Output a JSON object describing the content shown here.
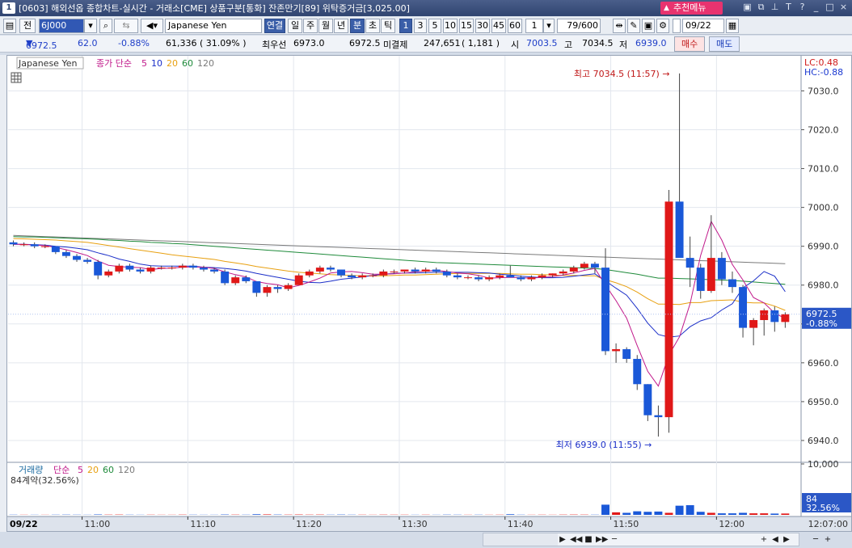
{
  "window": {
    "number": "1",
    "title": "[0603] 해외선옵 종합차트-실시간 - 거래소[CME] 상품구분[통화] 잔존만기[89] 위탁증거금[3,025.00]",
    "recommend_menu": "추천메뉴",
    "icons": [
      "restore-icon",
      "window-icon",
      "pin-icon",
      "text-icon",
      "help-icon",
      "minimize-icon",
      "maximize-icon",
      "close-icon"
    ],
    "icon_glyphs": [
      "▣",
      "⧉",
      "⊥",
      "T",
      "?",
      "_",
      "□",
      "×"
    ]
  },
  "toolbar": {
    "jeon": "전",
    "code": "6J000",
    "name": "Japanese Yen",
    "connect": "연결",
    "periods": [
      "일",
      "주",
      "월",
      "년"
    ],
    "units": [
      "분",
      "초",
      "틱"
    ],
    "intervals": [
      "1",
      "3",
      "5",
      "10",
      "15",
      "30",
      "45",
      "60"
    ],
    "interval_value": "1",
    "count": "79",
    "count_total": "/600",
    "date": "09/22"
  },
  "quote": {
    "price": "6972.5",
    "change": "62.0",
    "change_pct": "-0.88%",
    "volume": "61,336 ( 31.09% )",
    "best_bid_label": "최우선",
    "best_bid": "6973.0",
    "last": "6972.5",
    "open_interest_label": "미결제",
    "open_interest": "247,651",
    "oi_change": "( 1,181 )",
    "open_label": "시",
    "open": "7003.5",
    "high_label": "고",
    "high": "7034.5",
    "low_label": "저",
    "low": "6939.0",
    "buy_label": "매수",
    "sell_label": "매도"
  },
  "price_panel": {
    "legend_name": "Japanese Yen",
    "legend_ma": "종가 단순",
    "ma_periods": [
      "5",
      "10",
      "20",
      "60",
      "120"
    ],
    "ma_colors": [
      "#c0188a",
      "#1a2ec8",
      "#e8a010",
      "#1e8a3a",
      "#7a7a7a"
    ],
    "lc": "LC:0.48",
    "hc": "HC:-0.88",
    "high_annot": "최고 7034.5 (11:57)",
    "low_annot": "최저 6939.0 (11:55)",
    "last_price_label": "6972.5",
    "last_pct_label": "-0.88%"
  },
  "volume_panel": {
    "legend_name": "거래량",
    "legend_ma": "단순",
    "ma_periods": [
      "5",
      "20",
      "60",
      "120"
    ],
    "contracts": "84계약(32.56%)",
    "last_label": "84",
    "last_pct": "32.56%"
  },
  "time_axis": {
    "date": "09/22",
    "ticks": [
      "11:00",
      "11:10",
      "11:20",
      "11:30",
      "11:40",
      "11:50",
      "12:00"
    ],
    "current": "12:07:00"
  },
  "scroll_controls": [
    "▶",
    "◀◀",
    "■",
    "▶▶",
    "─",
    "+",
    "◀",
    "▶",
    "─",
    "+"
  ],
  "chart_data": {
    "type": "candlestick",
    "x_unit": "minute",
    "x_start": "10:53",
    "x_end": "12:07",
    "ylim": [
      6935,
      7038
    ],
    "yticks": [
      "7030.0",
      "7020.0",
      "7010.0",
      "7000.0",
      "6990.0",
      "6980.0",
      "6970.0",
      "6960.0",
      "6950.0",
      "6940.0"
    ],
    "ytick_values": [
      7030,
      7020,
      7010,
      7000,
      6990,
      6980,
      6970,
      6960,
      6950,
      6940
    ],
    "volume_yticks": [
      "10,000"
    ],
    "volume_ylim": [
      0,
      10000
    ],
    "candles": [
      [
        6991,
        6991.5,
        6990,
        6990.5
      ],
      [
        6990.5,
        6991,
        6990,
        6990.5
      ],
      [
        6990.5,
        6991,
        6989.5,
        6990
      ],
      [
        6990,
        6990.5,
        6989.5,
        6990
      ],
      [
        6990,
        6990,
        6988,
        6988.5
      ],
      [
        6988.5,
        6989,
        6987,
        6987.5
      ],
      [
        6987.5,
        6988,
        6986,
        6986.5
      ],
      [
        6986.5,
        6987,
        6985.5,
        6986
      ],
      [
        6986,
        6986.5,
        6981.5,
        6982.5
      ],
      [
        6982.5,
        6984,
        6982,
        6983.5
      ],
      [
        6983.5,
        6985.5,
        6983,
        6985
      ],
      [
        6985,
        6985.5,
        6983.5,
        6984
      ],
      [
        6984,
        6984.5,
        6983,
        6983.5
      ],
      [
        6983.5,
        6985,
        6983,
        6984.5
      ],
      [
        6984.5,
        6985,
        6984,
        6984.5
      ],
      [
        6984.5,
        6985,
        6984,
        6984.5
      ],
      [
        6984.5,
        6985.5,
        6984,
        6985
      ],
      [
        6985,
        6985.5,
        6984,
        6984.5
      ],
      [
        6984.5,
        6985,
        6983.5,
        6984
      ],
      [
        6984,
        6984.5,
        6983,
        6983.5
      ],
      [
        6983.5,
        6984,
        6980,
        6980.5
      ],
      [
        6980.5,
        6982.5,
        6980,
        6982
      ],
      [
        6982,
        6982.5,
        6980.5,
        6981
      ],
      [
        6981,
        6981,
        6977,
        6978
      ],
      [
        6978,
        6980,
        6977,
        6979.5
      ],
      [
        6979.5,
        6980,
        6978,
        6979
      ],
      [
        6979,
        6980.5,
        6978.5,
        6980
      ],
      [
        6980,
        6983,
        6980,
        6982.5
      ],
      [
        6982.5,
        6984,
        6982,
        6983.5
      ],
      [
        6983.5,
        6985,
        6983,
        6984.5
      ],
      [
        6984.5,
        6985,
        6983.5,
        6984
      ],
      [
        6984,
        6984,
        6982,
        6982.5
      ],
      [
        6982.5,
        6983,
        6981.5,
        6982
      ],
      [
        6982,
        6983,
        6981.5,
        6982.5
      ],
      [
        6982.5,
        6983,
        6982,
        6982.5
      ],
      [
        6982.5,
        6984,
        6982,
        6983.5
      ],
      [
        6983.5,
        6984,
        6983,
        6983.5
      ],
      [
        6983.5,
        6984,
        6983,
        6984
      ],
      [
        6984,
        6984.5,
        6983,
        6983.5
      ],
      [
        6983.5,
        6984.5,
        6983,
        6984
      ],
      [
        6984,
        6984.5,
        6983,
        6983.5
      ],
      [
        6983.5,
        6984,
        6982,
        6982.5
      ],
      [
        6982.5,
        6983,
        6981.5,
        6982
      ],
      [
        6982,
        6982.5,
        6981.5,
        6982
      ],
      [
        6982,
        6982.5,
        6981,
        6981.5
      ],
      [
        6981.5,
        6982.5,
        6981,
        6982
      ],
      [
        6982,
        6983,
        6981.5,
        6982.5
      ],
      [
        6982.5,
        6985,
        6982,
        6982
      ],
      [
        6982,
        6982.5,
        6981,
        6981.5
      ],
      [
        6981.5,
        6982.5,
        6981,
        6982
      ],
      [
        6982,
        6983,
        6981.5,
        6982.5
      ],
      [
        6982.5,
        6983,
        6982,
        6983
      ],
      [
        6983,
        6984,
        6982.5,
        6983.5
      ],
      [
        6983.5,
        6985,
        6983,
        6984.5
      ],
      [
        6984.5,
        6986,
        6984,
        6985.5
      ],
      [
        6985.5,
        6986,
        6983,
        6984.5
      ],
      [
        6984.5,
        6989.5,
        6962,
        6963
      ],
      [
        6963,
        6965,
        6960,
        6963.5
      ],
      [
        6963.5,
        6964,
        6960,
        6961
      ],
      [
        6961,
        6962,
        6953,
        6954.5
      ],
      [
        6954.5,
        6954.5,
        6945,
        6946.5
      ],
      [
        6946.5,
        6949,
        6941,
        6946
      ],
      [
        6946,
        7004.5,
        6942,
        7001.5
      ],
      [
        7001.5,
        7034.5,
        6990,
        6987
      ],
      [
        6987,
        6992.5,
        6979.5,
        6984.5
      ],
      [
        6984.5,
        6985.5,
        6976.5,
        6978.5
      ],
      [
        6978.5,
        6998,
        6978,
        6987
      ],
      [
        6987,
        6988.5,
        6980,
        6981.5
      ],
      [
        6981.5,
        6983.5,
        6978,
        6979.5
      ],
      [
        6979.5,
        6980,
        6966.5,
        6969
      ],
      [
        6969,
        6971.5,
        6964.5,
        6971
      ],
      [
        6971,
        6974,
        6967,
        6973.5
      ],
      [
        6973.5,
        6974.5,
        6968,
        6970.5
      ],
      [
        6970.5,
        6973,
        6969,
        6972.5
      ]
    ],
    "ma5": [
      6990.5,
      6990.5,
      6990.3,
      6990.2,
      6989.7,
      6989.1,
      6988.4,
      6987.6,
      6986.2,
      6985.1,
      6984.8,
      6984.6,
      6984.5,
      6984,
      6984.3,
      6984.4,
      6984.6,
      6984.7,
      6984.6,
      6984.3,
      6983.4,
      6982.7,
      6982.1,
      6980.9,
      6980.4,
      6980.1,
      6979.3,
      6979.9,
      6980.8,
      6981.8,
      6983.1,
      6983.4,
      6983.5,
      6983.2,
      6982.8,
      6982.8,
      6982.9,
      6983.1,
      6983.4,
      6983.6,
      6983.8,
      6983.5,
      6983.1,
      6982.9,
      6982.5,
      6981.8,
      6981.9,
      6982,
      6981.9,
      6981.8,
      6982,
      6982.2,
      6982.6,
      6983.1,
      6983.8,
      6984.3,
      6980,
      6976,
      6971.5,
      6964.4,
      6957.8,
      6954,
      6962,
      6966.7,
      6975.2,
      6987.6,
      6996.4,
      6991.6,
      6985.3,
      6981.3,
      6976.8,
      6975.4,
      6972.8,
      6971.4
    ],
    "ma10": [
      6990.5,
      6990.5,
      6990.4,
      6990.3,
      6990,
      6989.8,
      6989.5,
      6989.1,
      6988.3,
      6987.6,
      6986.7,
      6986.1,
      6985.4,
      6985,
      6984.9,
      6984.9,
      6984.9,
      6984.9,
      6984.6,
      6984.5,
      6984.3,
      6984,
      6983.6,
      6983,
      6982.5,
      6982,
      6981.5,
      6981,
      6980.7,
      6980.6,
      6981,
      6981.5,
      6981.8,
      6982.1,
      6982.5,
      6982.8,
      6983,
      6983.1,
      6983.1,
      6983.2,
      6983.3,
      6983.3,
      6983.3,
      6983.3,
      6983.2,
      6983.1,
      6982.8,
      6982.6,
      6982.3,
      6982.1,
      6981.9,
      6981.9,
      6982,
      6982.3,
      6982.6,
      6982.9,
      6981.1,
      6979.2,
      6977.4,
      6974,
      6970.2,
      6967.3,
      6966.6,
      6966.9,
      6969.3,
      6970.8,
      6971.6,
      6973.6,
      6975.2,
      6979.3,
      6981.1,
      6983.5,
      6982.3,
      6978.3
    ],
    "ma20": [
      6992,
      6991.9,
      6991.8,
      6991.7,
      6991.6,
      6991.4,
      6991.2,
      6991,
      6990.6,
      6990.2,
      6989.8,
      6989.4,
      6989,
      6988.6,
      6988.2,
      6987.8,
      6987.5,
      6987.2,
      6986.9,
      6986.6,
      6986.1,
      6985.7,
      6985.3,
      6984.8,
      6984.4,
      6984,
      6983.6,
      6983.3,
      6983.1,
      6982.9,
      6982.7,
      6982.6,
      6982.5,
      6982.4,
      6982.4,
      6982.4,
      6982.5,
      6982.6,
      6982.6,
      6982.7,
      6982.8,
      6982.9,
      6983,
      6983,
      6983,
      6983,
      6983,
      6982.9,
      6982.8,
      6982.8,
      6982.7,
      6982.6,
      6982.5,
      6982.5,
      6982.4,
      6982.4,
      6981.4,
      6980.6,
      6979.6,
      6978.2,
      6976.5,
      6975.1,
      6975.1,
      6975,
      6975.5,
      6975.5,
      6976,
      6976.1,
      6976.2,
      6975.6,
      6975.4,
      6975.4,
      6974.6,
      6973.5
    ],
    "ma60": [
      6992.5,
      6992.4,
      6992.4,
      6992.3,
      6992.2,
      6992.1,
      6992,
      6991.9,
      6991.8,
      6991.6,
      6991.5,
      6991.3,
      6991.2,
      6991,
      6990.9,
      6990.7,
      6990.6,
      6990.4,
      6990.2,
      6990,
      6989.8,
      6989.6,
      6989.4,
      6989.2,
      6989,
      6988.8,
      6988.6,
      6988.4,
      6988.2,
      6988,
      6987.8,
      6987.6,
      6987.4,
      6987.2,
      6987,
      6986.8,
      6986.6,
      6986.4,
      6986.2,
      6986,
      6985.8,
      6985.7,
      6985.6,
      6985.5,
      6985.4,
      6985.3,
      6985.2,
      6985.1,
      6985,
      6984.9,
      6984.8,
      6984.7,
      6984.6,
      6984.5,
      6984.4,
      6984.3,
      6984,
      6983.6,
      6983.2,
      6982.8,
      6982.3,
      6981.8,
      6981.8,
      6981.7,
      6981.6,
      6981.5,
      6981.4,
      6981.3,
      6981.2,
      6981,
      6980.8,
      6980.6,
      6980.4,
      6980.2
    ],
    "ma120": [
      6992.8,
      6992.7,
      6992.6,
      6992.5,
      6992.4,
      6992.3,
      6992.2,
      6992.1,
      6992,
      6991.9,
      6991.8,
      6991.7,
      6991.6,
      6991.5,
      6991.4,
      6991.3,
      6991.2,
      6991.1,
      6991,
      6990.9,
      6990.8,
      6990.7,
      6990.6,
      6990.5,
      6990.4,
      6990.3,
      6990.2,
      6990.1,
      6990,
      6989.9,
      6989.8,
      6989.7,
      6989.6,
      6989.5,
      6989.4,
      6989.3,
      6989.2,
      6989.1,
      6989,
      6988.9,
      6988.8,
      6988.7,
      6988.6,
      6988.5,
      6988.4,
      6988.3,
      6988.2,
      6988.1,
      6988,
      6987.9,
      6987.8,
      6987.7,
      6987.6,
      6987.5,
      6987.4,
      6987.3,
      6987.2,
      6987.1,
      6987,
      6986.9,
      6986.8,
      6986.7,
      6986.6,
      6986.5,
      6986.4,
      6986.3,
      6986.2,
      6986.1,
      6986,
      6985.9,
      6985.8,
      6985.7,
      6985.6,
      6985.5
    ],
    "volumes": [
      40,
      30,
      30,
      25,
      40,
      50,
      40,
      30,
      80,
      50,
      60,
      40,
      30,
      40,
      30,
      30,
      50,
      40,
      30,
      30,
      70,
      50,
      40,
      120,
      90,
      60,
      50,
      70,
      50,
      60,
      40,
      60,
      40,
      40,
      30,
      50,
      40,
      40,
      30,
      40,
      30,
      50,
      40,
      30,
      40,
      30,
      40,
      120,
      40,
      30,
      40,
      30,
      50,
      60,
      50,
      40,
      2000,
      500,
      400,
      700,
      600,
      650,
      400,
      1800,
      1900,
      600,
      400,
      300,
      300,
      400,
      300,
      300,
      250,
      260
    ],
    "colors": {
      "up": "#e01818",
      "down": "#1a58d8",
      "wick": "#333333"
    }
  }
}
